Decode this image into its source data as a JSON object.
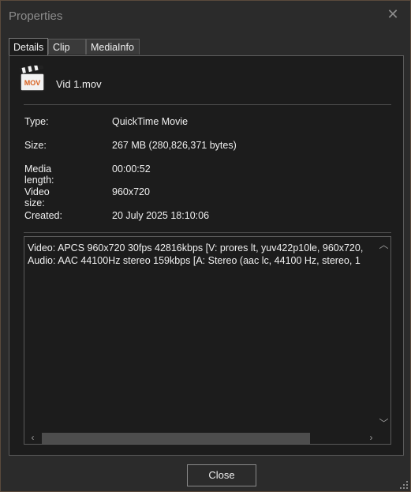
{
  "window": {
    "title": "Properties"
  },
  "tabs": [
    {
      "label": "Details",
      "active": true
    },
    {
      "label": "Clip",
      "active": false
    },
    {
      "label": "MediaInfo",
      "active": false
    }
  ],
  "file": {
    "name": "Vid 1.mov",
    "icon": "mov-file-icon",
    "icon_text": "MOV"
  },
  "details": [
    {
      "label": "Type:",
      "value": "QuickTime Movie"
    },
    {
      "label": "Size:",
      "value": "267 MB (280,826,371 bytes)"
    },
    {
      "label": "Media length:",
      "value": "00:00:52"
    },
    {
      "label": "Video size:",
      "value": "960x720"
    },
    {
      "label": "Created:",
      "value": "20 July 2025 18:10:06"
    }
  ],
  "media_info": {
    "lines": [
      "Video: APCS 960x720 30fps 42816kbps [V: prores lt, yuv422p10le, 960x720,",
      "Audio: AAC 44100Hz stereo 159kbps [A: Stereo (aac lc, 44100 Hz, stereo, 1"
    ]
  },
  "buttons": {
    "close": "Close"
  },
  "colors": {
    "background": "#2b2b2b",
    "panel": "#1c1c1c",
    "border": "#5a5a5a"
  }
}
